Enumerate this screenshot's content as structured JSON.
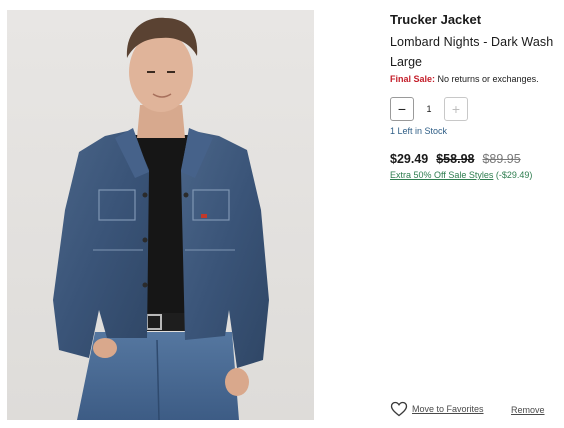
{
  "product": {
    "name": "Trucker Jacket",
    "color": "Lombard Nights - Dark Wash",
    "size": "Large",
    "final_sale_label": "Final Sale:",
    "final_sale_text": " No returns or exchanges.",
    "image_alt": "Model wearing dark wash denim trucker jacket"
  },
  "quantity": {
    "value": "1",
    "decrement_symbol": "−",
    "increment_symbol": "+",
    "stock_note": "1 Left in Stock"
  },
  "pricing": {
    "sale_price": "$29.49",
    "discounted_price": "$58.98",
    "original_price": "$89.95",
    "promo_link": "Extra 50% Off Sale Styles",
    "promo_savings": " (-$29.49)"
  },
  "actions": {
    "favorites_label": "Move to Favorites",
    "remove_label": "Remove"
  },
  "colors": {
    "final_sale": "#c41e2a",
    "stock": "#2f5e86",
    "promo": "#2e7d4f",
    "denim": "#3f5a7d"
  }
}
